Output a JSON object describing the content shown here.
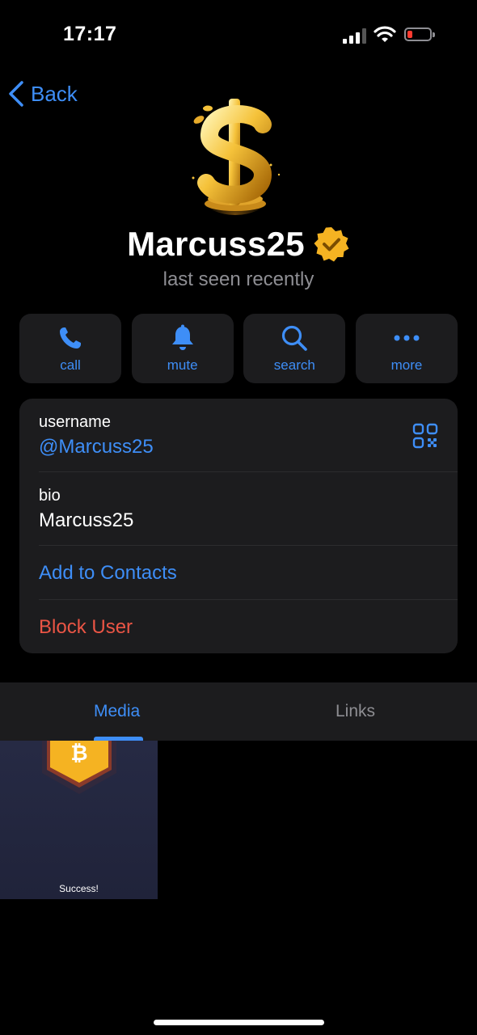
{
  "status_bar": {
    "time": "17:17"
  },
  "nav": {
    "back_label": "Back"
  },
  "profile": {
    "name": "Marcuss25",
    "status": "last seen recently"
  },
  "actions": [
    {
      "label": "call",
      "icon": "phone-icon"
    },
    {
      "label": "mute",
      "icon": "bell-icon"
    },
    {
      "label": "search",
      "icon": "search-icon"
    },
    {
      "label": "more",
      "icon": "more-dots-icon"
    }
  ],
  "info": {
    "username_caption": "username",
    "username_value": "@Marcuss25",
    "bio_caption": "bio",
    "bio_value": "Marcuss25",
    "add_contact": "Add to Contacts",
    "block_user": "Block User"
  },
  "tabs": [
    {
      "label": "Media",
      "active": true
    },
    {
      "label": "Links",
      "active": false
    }
  ],
  "media": {
    "thumb_text": "Success!"
  },
  "colors": {
    "accent": "#3e8ef7",
    "danger": "#eb5545",
    "card": "#1c1c1e",
    "gold": "#f5b322"
  }
}
